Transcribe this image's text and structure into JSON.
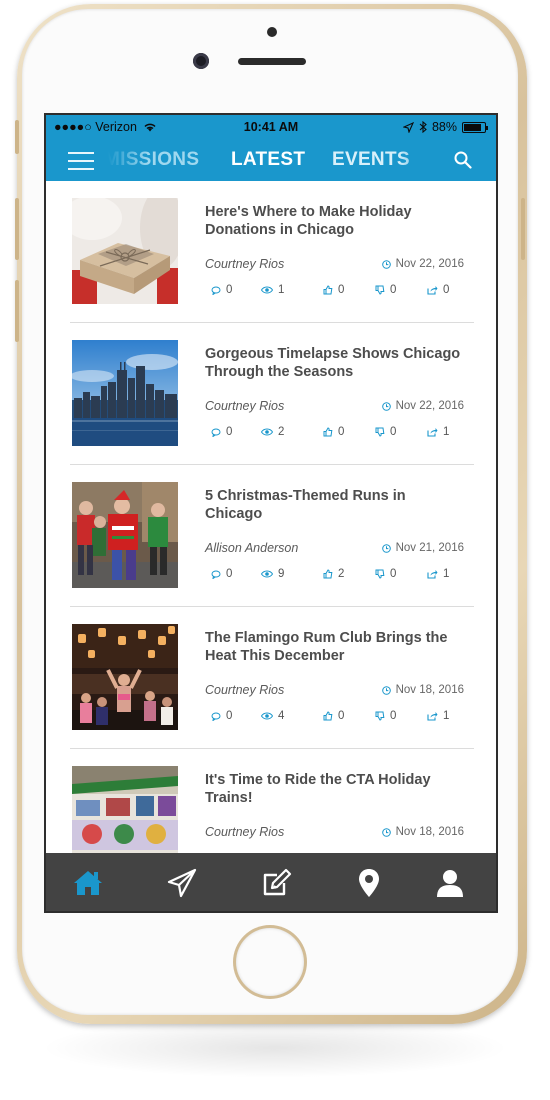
{
  "colors": {
    "accent": "#1a97cc",
    "tabbar": "#434343",
    "phone_gold": "#d8c29c"
  },
  "status_bar": {
    "carrier": "●●●●○ Verizon",
    "time": "10:41 AM",
    "battery": "88%"
  },
  "nav": {
    "tabs": [
      {
        "label": "MISSIONS"
      },
      {
        "label": "LATEST",
        "active": true
      },
      {
        "label": "EVENTS"
      }
    ],
    "icons": [
      "menu-icon",
      "search-icon"
    ]
  },
  "articles": [
    {
      "title": "Here's Where to Make Holiday Donations in Chicago",
      "author": "Courtney Rios",
      "date": "Nov 22, 2016",
      "comments": "0",
      "views": "1",
      "likes": "0",
      "dislikes": "0",
      "shares": "0",
      "image": "gift-box-photo"
    },
    {
      "title": "Gorgeous Timelapse Shows Chicago Through the Seasons",
      "author": "Courtney Rios",
      "date": "Nov 22, 2016",
      "comments": "0",
      "views": "2",
      "likes": "0",
      "dislikes": "0",
      "shares": "1",
      "image": "chicago-skyline-photo"
    },
    {
      "title": "5 Christmas-Themed Runs in Chicago",
      "author": "Allison Anderson",
      "date": "Nov 21, 2016",
      "comments": "0",
      "views": "9",
      "likes": "2",
      "dislikes": "0",
      "shares": "1",
      "image": "christmas-runners-photo"
    },
    {
      "title": "The Flamingo Rum Club Brings the Heat This December",
      "author": "Courtney Rios",
      "date": "Nov 18, 2016",
      "comments": "0",
      "views": "4",
      "likes": "0",
      "dislikes": "0",
      "shares": "1",
      "image": "rum-club-party-photo"
    },
    {
      "title": "It's Time to Ride the CTA Holiday Trains!",
      "author": "Courtney Rios",
      "date": "Nov 18, 2016",
      "image": "cta-holiday-train-photo"
    }
  ],
  "tab_bar": {
    "items": [
      "home-icon",
      "send-icon",
      "edit-icon",
      "location-icon",
      "user-icon"
    ],
    "active": "home-icon"
  }
}
